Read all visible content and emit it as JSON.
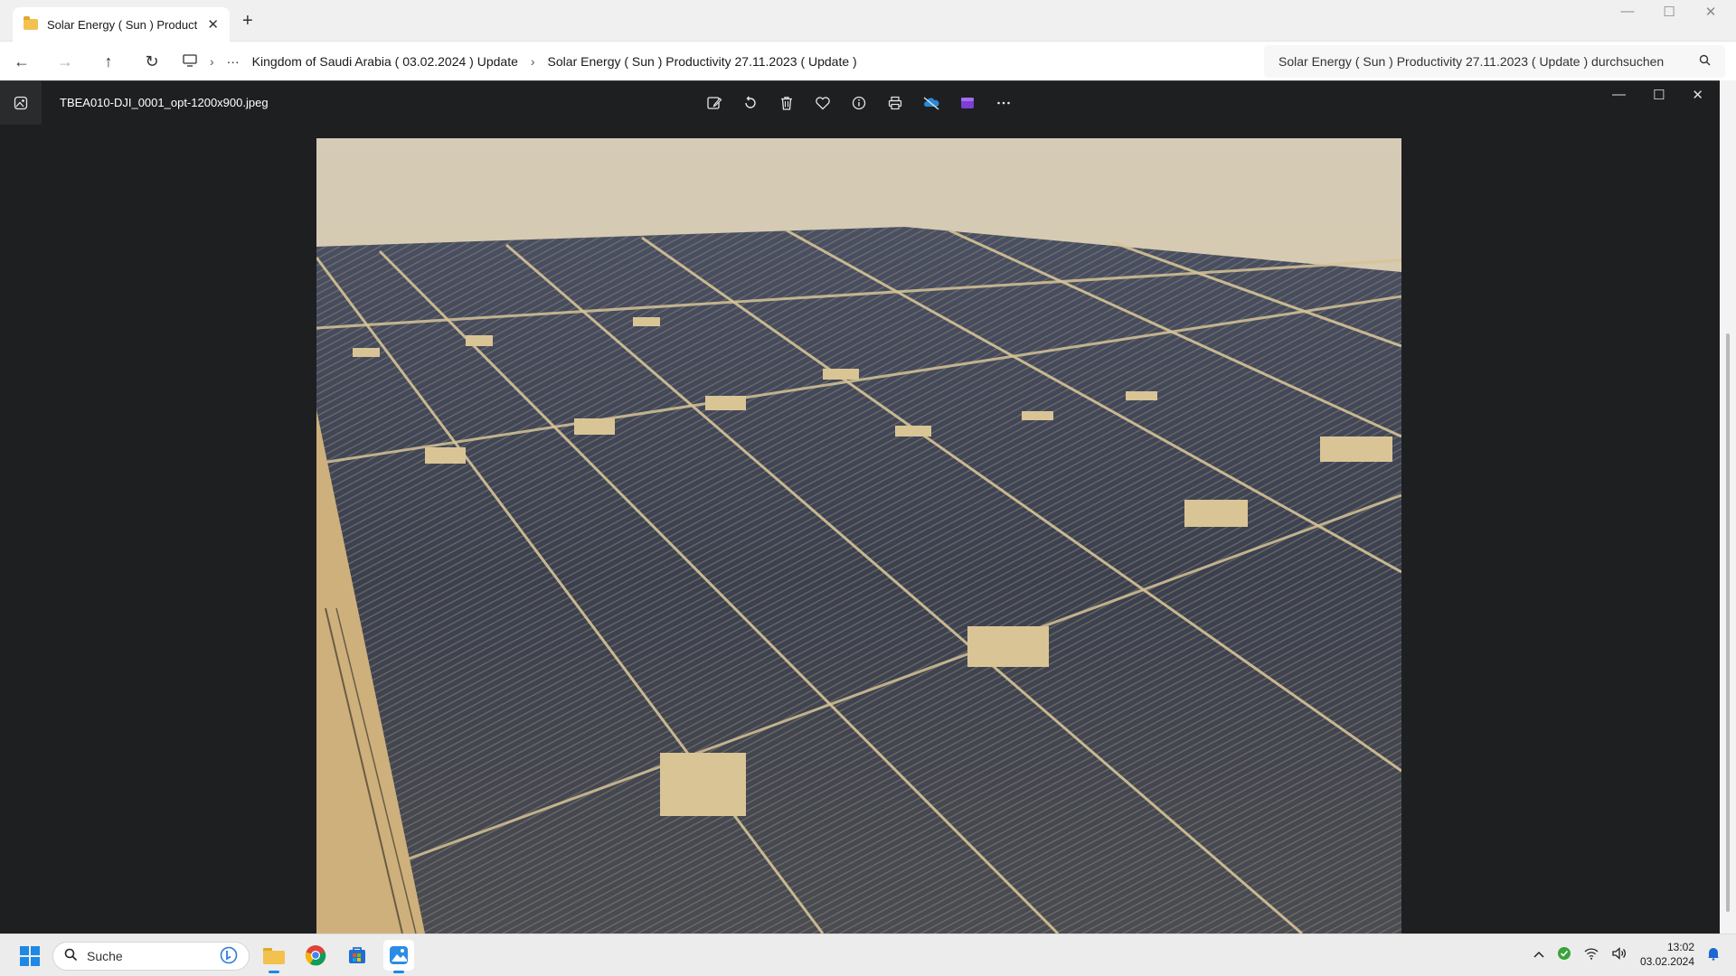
{
  "explorer": {
    "tab_title": "Solar Energy ( Sun ) Productivi",
    "breadcrumbs": [
      "Kingdom of Saudi Arabia ( 03.02.2024 ) Update",
      "Solar Energy ( Sun ) Productivity 27.11.2023 ( Update )"
    ],
    "search_placeholder": "Solar Energy ( Sun ) Productivity 27.11.2023 ( Update ) durchsuchen"
  },
  "photos": {
    "filename": "TBEA010-DJI_0001_opt-1200x900.jpeg",
    "toolbar_icons": [
      "edit-icon",
      "rotate-icon",
      "delete-icon",
      "favorite-icon",
      "info-icon",
      "print-icon",
      "onedrive-icon",
      "clipchamp-icon",
      "more-icon"
    ]
  },
  "taskbar": {
    "search_label": "Suche",
    "time": "13:02",
    "date": "03.02.2024"
  },
  "colors": {
    "photos_bg": "#1e1f21",
    "accent": "#1e88e5",
    "sand": "#d9c69a",
    "panel": "#3d4150"
  }
}
